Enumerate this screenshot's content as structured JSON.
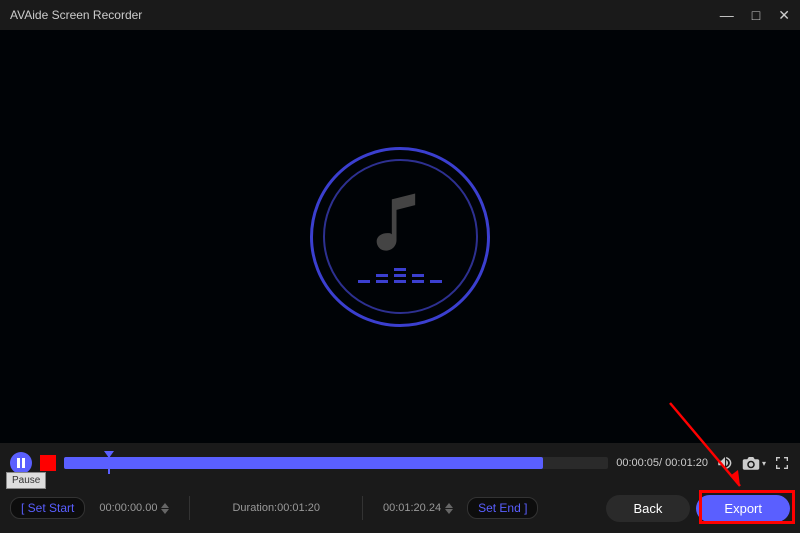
{
  "titlebar": {
    "title": "AVAide Screen Recorder"
  },
  "tooltip": "Pause",
  "timeline": {
    "current": "00:00:05",
    "total": "00:01:20"
  },
  "trim": {
    "set_start_label": "Set Start",
    "start_time": "00:00:00.00",
    "duration_label": "Duration:",
    "duration_value": "00:01:20",
    "end_time": "00:01:20.24",
    "set_end_label": "Set End"
  },
  "buttons": {
    "back": "Back",
    "export": "Export"
  },
  "icons": {
    "minimize": "—",
    "maximize": "□",
    "close": "✕",
    "volume": "volume",
    "camera": "camera",
    "fullscreen": "fullscreen"
  }
}
